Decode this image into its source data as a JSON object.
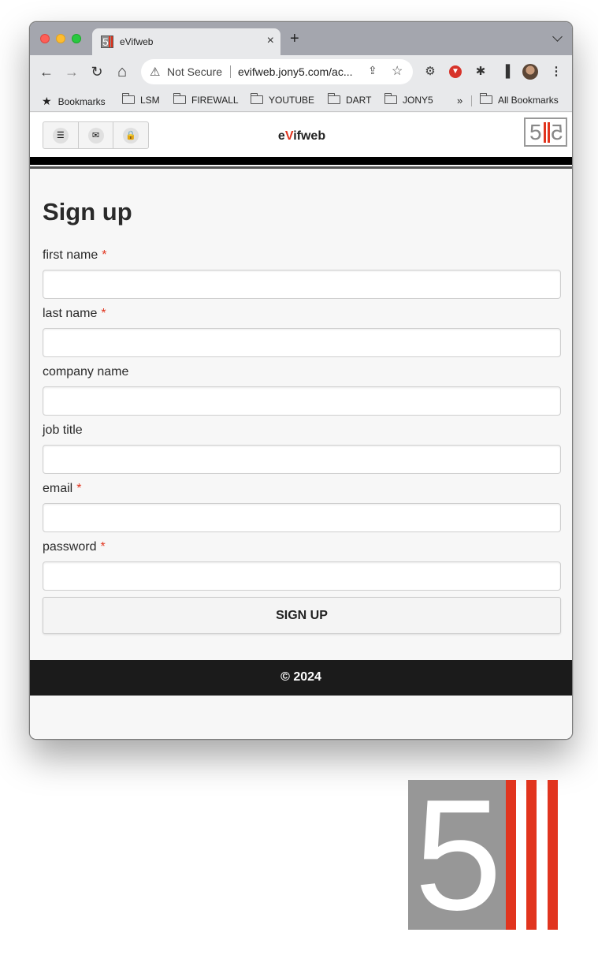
{
  "browser": {
    "tab": {
      "title": "eVifweb",
      "close": "×"
    },
    "new_tab": "+",
    "nav": {
      "back": "←",
      "forward": "→",
      "reload": "↻",
      "home": "⌂"
    },
    "omnibox": {
      "security_label": "Not Secure",
      "url": "evifweb.jony5.com/ac..."
    },
    "bookmarks": {
      "star_label": "Bookmarks",
      "folders": [
        "LSM",
        "FIREWALL",
        "YOUTUBE",
        "DART",
        "JONY5"
      ],
      "overflow": "»",
      "all_label": "All Bookmarks"
    }
  },
  "site": {
    "title_prefix": "e",
    "title_accent": "V",
    "title_suffix": "ifweb",
    "header_icons": [
      "menu-icon",
      "mail-icon",
      "lock-icon"
    ],
    "form": {
      "heading": "Sign up",
      "fields": [
        {
          "label": "first name",
          "required": "*"
        },
        {
          "label": "last name",
          "required": "*"
        },
        {
          "label": "company name",
          "required": ""
        },
        {
          "label": "job title",
          "required": ""
        },
        {
          "label": "email",
          "required": "*"
        },
        {
          "label": "password",
          "required": "*"
        }
      ],
      "submit_label": "SIGN UP"
    },
    "footer": "© 2024"
  },
  "colors": {
    "accent": "#e1341e",
    "logo_grey": "#979797",
    "footer_bg": "#1b1b1b",
    "page_bg": "#f7f7f7"
  }
}
